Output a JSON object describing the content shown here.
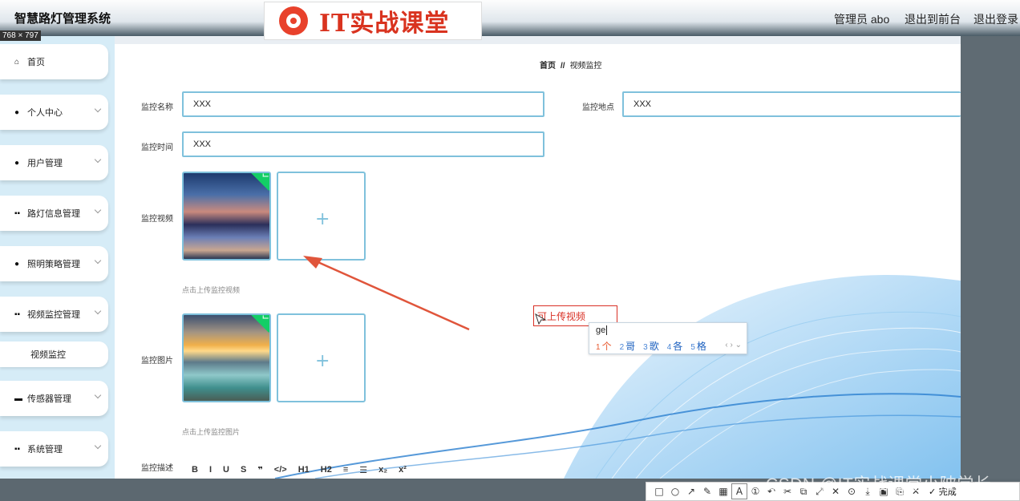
{
  "header": {
    "app_title": "智慧路灯管理系统",
    "brand_text": "IT实战课堂",
    "admin_label": "管理员 abo",
    "to_front_link": "退出到前台",
    "logout_link": "退出登录",
    "dimension_label": "768 × 797"
  },
  "sidebar": {
    "items": [
      {
        "label": "首页",
        "icon": "home-icon",
        "has_chevron": false
      },
      {
        "label": "个人中心",
        "icon": "user-icon",
        "has_chevron": true
      },
      {
        "label": "用户管理",
        "icon": "pin-icon",
        "has_chevron": true
      },
      {
        "label": "路灯信息管理",
        "icon": "grid-icon",
        "has_chevron": true
      },
      {
        "label": "照明策略管理",
        "icon": "user-icon",
        "has_chevron": true
      },
      {
        "label": "视频监控管理",
        "icon": "grid-icon",
        "has_chevron": true
      },
      {
        "label": "传感器管理",
        "icon": "monitor-icon",
        "has_chevron": true
      },
      {
        "label": "系统管理",
        "icon": "grid-icon",
        "has_chevron": true
      }
    ],
    "sub_item": "视频监控"
  },
  "breadcrumb": {
    "home": "首页",
    "separator": "//",
    "current": "视频监控"
  },
  "form": {
    "name_label": "监控名称",
    "name_value": "XXX",
    "location_label": "监控地点",
    "location_value": "XXX",
    "time_label": "监控时间",
    "time_value": "XXX",
    "video_label": "监控视频",
    "video_hint": "点击上传监控视频",
    "image_label": "监控图片",
    "image_hint": "点击上传监控图片",
    "desc_label": "监控描述",
    "editor_buttons": [
      "B",
      "I",
      "U",
      "S",
      "❞",
      "</>",
      "H1",
      "H2",
      "≡",
      "☰",
      "x₂",
      "x²"
    ]
  },
  "annotation": {
    "text": "可上传视频"
  },
  "ime": {
    "typed": "ge",
    "candidates": [
      {
        "n": "1",
        "c": "个"
      },
      {
        "n": "2",
        "c": "哥"
      },
      {
        "n": "3",
        "c": "歌"
      },
      {
        "n": "4",
        "c": "各"
      },
      {
        "n": "5",
        "c": "格"
      }
    ],
    "nav": "‹ › ⌄"
  },
  "snip_toolbar": {
    "tools": [
      "□",
      "○",
      "↗",
      "✎",
      "▦",
      "A",
      "①",
      "↶",
      "✂",
      "⧉",
      "⤢",
      "✕",
      "⊙",
      "⤓",
      "▣",
      "⎘",
      "✕"
    ],
    "done_label": "✓ 完成"
  },
  "watermark": "CSDN @IT实战课堂小陂学长",
  "colors": {
    "accent": "#7fc1dc",
    "sidebar_bg": "#d6ecf7",
    "annotation": "#d93025",
    "success": "#13ce66"
  }
}
